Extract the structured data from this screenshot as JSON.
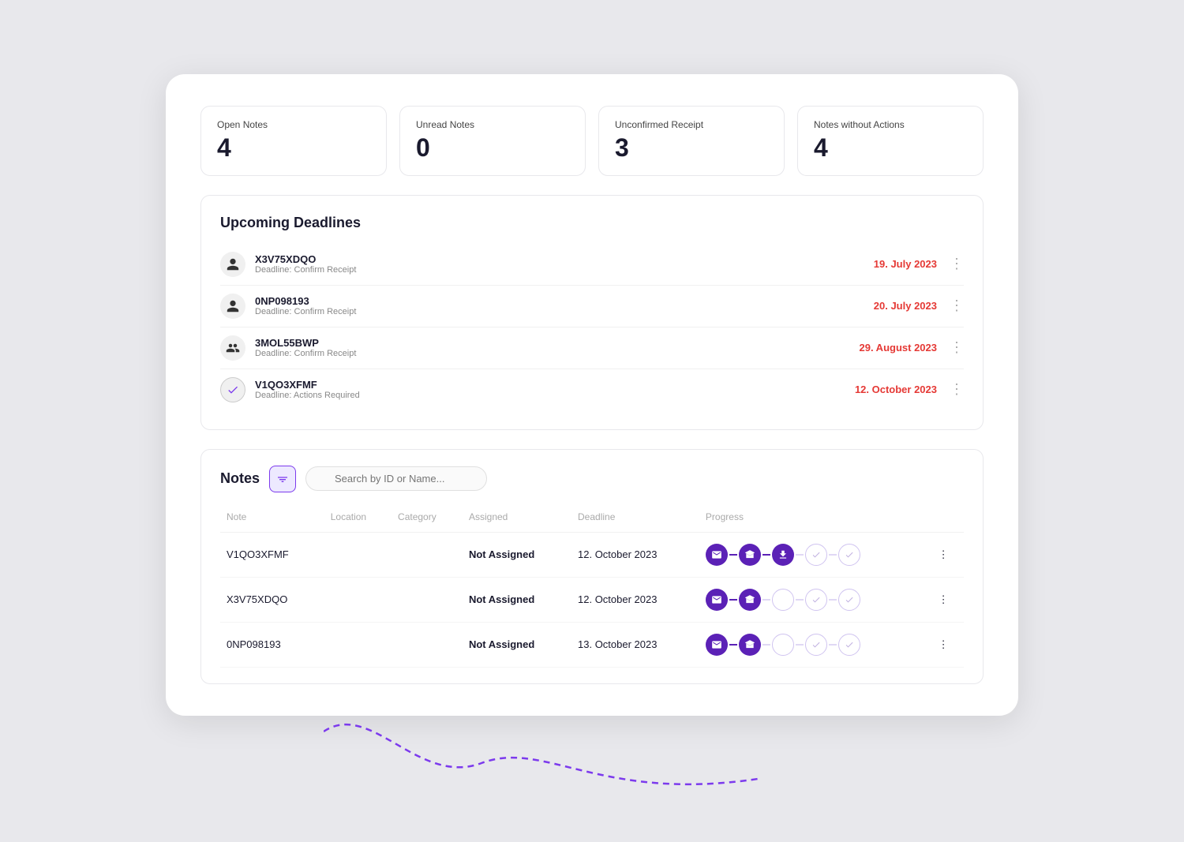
{
  "stats": [
    {
      "label": "Open Notes",
      "value": "4"
    },
    {
      "label": "Unread Notes",
      "value": "0"
    },
    {
      "label": "Unconfirmed Receipt",
      "value": "3"
    },
    {
      "label": "Notes without Actions",
      "value": "4"
    }
  ],
  "deadlines": {
    "title": "Upcoming Deadlines",
    "items": [
      {
        "id": "X3V75XDQO",
        "sub": "Deadline: Confirm Receipt",
        "date": "19. July 2023",
        "icon": "person"
      },
      {
        "id": "0NP098193",
        "sub": "Deadline: Confirm Receipt",
        "date": "20. July 2023",
        "icon": "person"
      },
      {
        "id": "3MOL55BWP",
        "sub": "Deadline: Confirm Receipt",
        "date": "29. August 2023",
        "icon": "person-stack"
      },
      {
        "id": "V1QO3XFMF",
        "sub": "Deadline: Actions Required",
        "date": "12. October 2023",
        "icon": "check"
      }
    ]
  },
  "notes": {
    "title": "Notes",
    "search_placeholder": "Search by ID or Name...",
    "filter_label": "filter",
    "columns": [
      "Note",
      "Location",
      "Category",
      "Assigned",
      "Deadline",
      "Progress"
    ],
    "rows": [
      {
        "id": "V1QO3XFMF",
        "location": "",
        "category": "",
        "assigned": "Not Assigned",
        "deadline": "12. October 2023",
        "progress": [
          true,
          true,
          true,
          false,
          false
        ]
      },
      {
        "id": "X3V75XDQO",
        "location": "",
        "category": "",
        "assigned": "Not Assigned",
        "deadline": "12. October 2023",
        "progress": [
          true,
          true,
          false,
          false,
          false
        ]
      },
      {
        "id": "0NP098193",
        "location": "",
        "category": "",
        "assigned": "Not Assigned",
        "deadline": "13. October 2023",
        "progress": [
          true,
          true,
          false,
          false,
          false
        ]
      }
    ]
  }
}
